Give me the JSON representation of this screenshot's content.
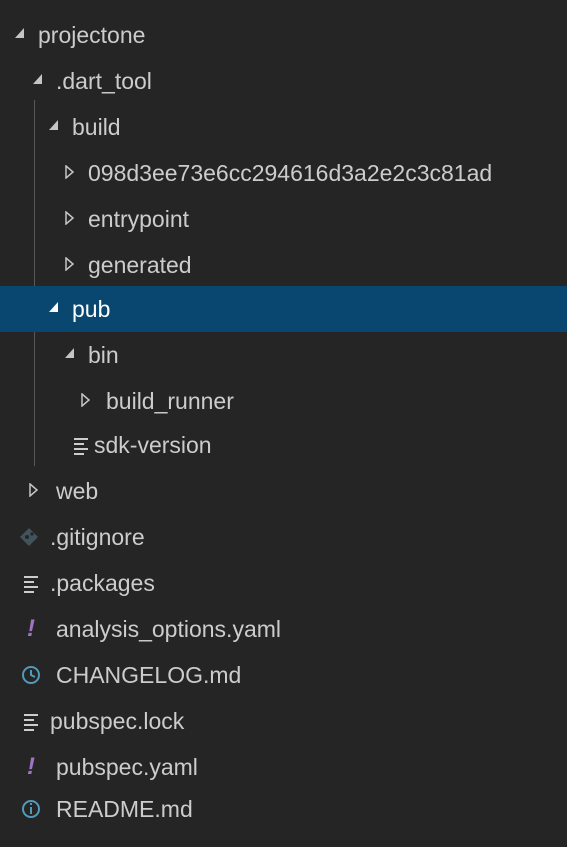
{
  "explorer": {
    "items": [
      {
        "label": "projectone",
        "icon": "chevron-expanded-icon"
      },
      {
        "label": ".dart_tool",
        "icon": "chevron-expanded-icon"
      },
      {
        "label": "build",
        "icon": "chevron-expanded-icon"
      },
      {
        "label": "098d3ee73e6cc294616d3a2e2c3c81ad",
        "icon": "chevron-collapsed-icon"
      },
      {
        "label": "entrypoint",
        "icon": "chevron-collapsed-icon"
      },
      {
        "label": "generated",
        "icon": "chevron-collapsed-icon"
      },
      {
        "label": "pub",
        "icon": "chevron-expanded-icon",
        "selected": true
      },
      {
        "label": "bin",
        "icon": "chevron-expanded-icon"
      },
      {
        "label": "build_runner",
        "icon": "chevron-collapsed-icon"
      },
      {
        "label": "sdk-version",
        "icon": "text-file-icon"
      },
      {
        "label": "web",
        "icon": "chevron-collapsed-icon"
      },
      {
        "label": ".gitignore",
        "icon": "git-icon"
      },
      {
        "label": ".packages",
        "icon": "text-file-icon"
      },
      {
        "label": "analysis_options.yaml",
        "icon": "yaml-icon"
      },
      {
        "label": "CHANGELOG.md",
        "icon": "changelog-icon"
      },
      {
        "label": "pubspec.lock",
        "icon": "text-file-icon"
      },
      {
        "label": "pubspec.yaml",
        "icon": "yaml-icon"
      },
      {
        "label": "README.md",
        "icon": "info-icon"
      }
    ]
  },
  "colors": {
    "background": "#252526",
    "selection": "#094771",
    "text": "#cccccc",
    "selected_text": "#ffffff",
    "yaml_icon": "#a074c4",
    "info_icon": "#519aba",
    "git_icon": "#41535b"
  }
}
